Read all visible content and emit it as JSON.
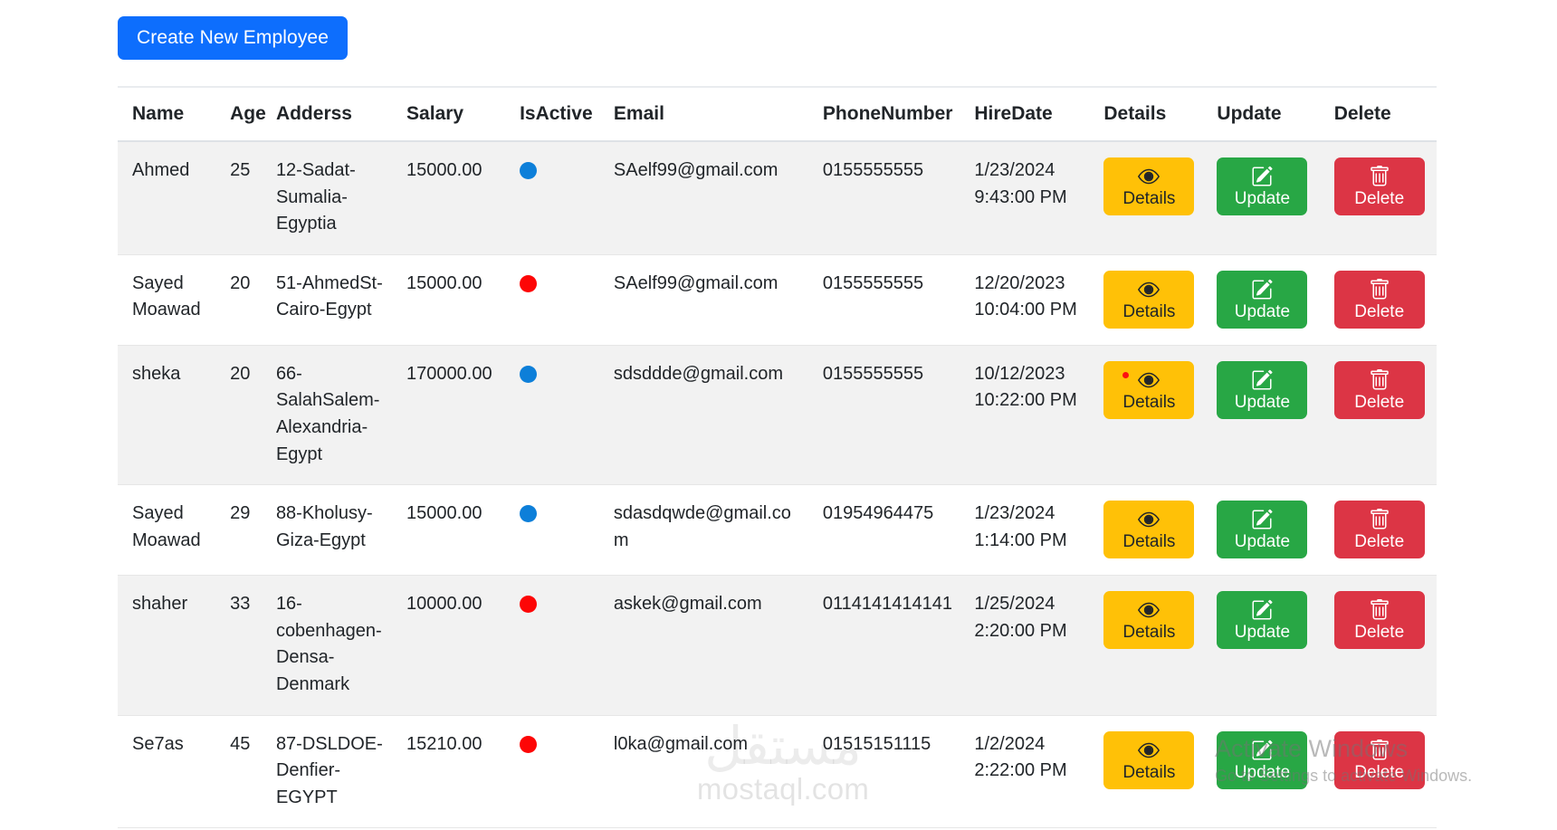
{
  "toolbar": {
    "create_label": "Create New Employee"
  },
  "table": {
    "columns": [
      {
        "key": "name",
        "label": "Name"
      },
      {
        "key": "age",
        "label": "Age"
      },
      {
        "key": "addr",
        "label": "Adderss"
      },
      {
        "key": "salary",
        "label": "Salary"
      },
      {
        "key": "active",
        "label": "IsActive"
      },
      {
        "key": "email",
        "label": "Email"
      },
      {
        "key": "phone",
        "label": "PhoneNumber"
      },
      {
        "key": "hire",
        "label": "HireDate"
      },
      {
        "key": "det",
        "label": "Details"
      },
      {
        "key": "upd",
        "label": "Update"
      },
      {
        "key": "del",
        "label": "Delete"
      }
    ],
    "rows": [
      {
        "name": "Ahmed",
        "age": "25",
        "addr": "12-Sadat-Sumalia-Egyptia",
        "salary": "15000.00",
        "active": true,
        "email": "SAelf99@gmail.com",
        "phone": "0155555555",
        "hire_date": "1/23/2024",
        "hire_time": "9:43:00 PM",
        "cursor_on_details": false
      },
      {
        "name": "Sayed Moawad",
        "age": "20",
        "addr": "51-AhmedSt-Cairo-Egypt",
        "salary": "15000.00",
        "active": false,
        "email": "SAelf99@gmail.com",
        "phone": "0155555555",
        "hire_date": "12/20/2023",
        "hire_time": "10:04:00 PM",
        "cursor_on_details": false
      },
      {
        "name": "sheka",
        "age": "20",
        "addr": "66-SalahSalem-Alexandria-Egypt",
        "salary": "170000.00",
        "active": true,
        "email": "sdsddde@gmail.com",
        "phone": "0155555555",
        "hire_date": "10/12/2023",
        "hire_time": "10:22:00 PM",
        "cursor_on_details": true
      },
      {
        "name": "Sayed Moawad",
        "age": "29",
        "addr": "88-Kholusy-Giza-Egypt",
        "salary": "15000.00",
        "active": true,
        "email": "sdasdqwde@gmail.com",
        "phone": "01954964475",
        "hire_date": "1/23/2024",
        "hire_time": "1:14:00 PM",
        "cursor_on_details": false
      },
      {
        "name": "shaher",
        "age": "33",
        "addr": "16-cobenhagen-Densa-Denmark",
        "salary": "10000.00",
        "active": false,
        "email": "askek@gmail.com",
        "phone": "0114141414141",
        "hire_date": "1/25/2024",
        "hire_time": "2:20:00 PM",
        "cursor_on_details": false
      },
      {
        "name": "Se7as",
        "age": "45",
        "addr": "87-DSLDOE-Denfier-EGYPT",
        "salary": "15210.00",
        "active": false,
        "email": "l0ka@gmail.com",
        "phone": "01515151115",
        "hire_date": "1/2/2024",
        "hire_time": "2:22:00 PM",
        "cursor_on_details": false
      }
    ],
    "actions": {
      "details_label": "Details",
      "update_label": "Update",
      "delete_label": "Delete",
      "details_icon": "eye-icon",
      "update_icon": "pencil-square-icon",
      "delete_icon": "trash-icon"
    }
  },
  "watermarks": {
    "mostaql_ar": "مستقل",
    "mostaql_en": "mostaql.com",
    "windows_title": "Activate Windows",
    "windows_sub": "Go to Settings to activate Windows."
  },
  "colors": {
    "primary": "#0d6efd",
    "warning": "#ffc107",
    "success": "#28a745",
    "danger": "#dc3545",
    "active_dot": "#0d7fd9",
    "inactive_dot": "#fd0606"
  }
}
